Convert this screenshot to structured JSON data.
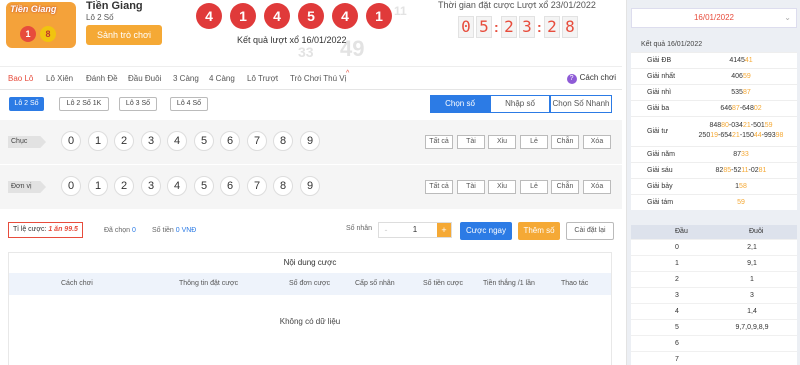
{
  "header": {
    "logo_text": "Tiền Giang",
    "logo_digits": [
      "1",
      "8"
    ],
    "game_title": "Tiền Giang",
    "game_sub": "Lô 2 Số",
    "switch_label": "Sảnh trò chơi",
    "balls": [
      "4",
      "1",
      "4",
      "5",
      "4",
      "1"
    ],
    "result_label": "Kết quả lượt xổ 16/01/2022",
    "watermark_numbers": [
      "49",
      "33",
      "11"
    ],
    "time_label": "Thời gian đặt cược Lượt xổ 23/01/2022",
    "timer": [
      "0",
      "5",
      "2",
      "3",
      "2",
      "8"
    ]
  },
  "tabs": {
    "items": [
      "Bao Lô",
      "Lô Xiên",
      "Đánh Đề",
      "Đầu Đuôi",
      "3 Càng",
      "4 Càng",
      "Lô Trượt",
      "Trò Chơi Thú Vị"
    ],
    "active": "Bao Lô",
    "hot_mark": "^",
    "help": "Cách chơi",
    "help_icon": "?"
  },
  "subtabs": [
    "Lô 2 Số",
    "Lô 2 Số 1K",
    "Lô 3 Số",
    "Lô 4 Số"
  ],
  "modes": [
    "Chọn số",
    "Nhập số",
    "Chọn Số Nhanh"
  ],
  "rows": [
    {
      "label": "Chục",
      "numbers": [
        "0",
        "1",
        "2",
        "3",
        "4",
        "5",
        "6",
        "7",
        "8",
        "9"
      ]
    },
    {
      "label": "Đơn vị",
      "numbers": [
        "0",
        "1",
        "2",
        "3",
        "4",
        "5",
        "6",
        "7",
        "8",
        "9"
      ]
    }
  ],
  "quick": [
    "Tất cả",
    "Tài",
    "Xỉu",
    "Lẻ",
    "Chẵn",
    "Xóa"
  ],
  "betbar": {
    "rate_label": "Tỉ lệ cược:",
    "rate_value": "1 ăn 99.5",
    "selected_label": "Đã chọn",
    "selected_value": "0",
    "amount_label": "Số tiền",
    "amount_value": "0 VNĐ",
    "multiplier_label": "Số nhân",
    "multiplier_value": "1",
    "bet_now": "Cược ngay",
    "add_number": "Thêm số",
    "reset": "Cài đặt lại"
  },
  "bet_table": {
    "title": "Nội dung cược",
    "columns": [
      "Cách chơi",
      "Thông tin đặt cược",
      "Số đơn cược",
      "Cấp số nhân",
      "Số tiền cược",
      "Tiền thắng /1 lần",
      "Thao tác"
    ],
    "empty": "Không có dữ liệu"
  },
  "right": {
    "date": "16/01/2022",
    "title": "Kết quả 16/01/2022",
    "prizes": [
      {
        "name": "Giải ĐB",
        "parts": [
          [
            "4145",
            ""
          ],
          [
            "41",
            "hl"
          ]
        ]
      },
      {
        "name": "Giải nhất",
        "parts": [
          [
            "406",
            ""
          ],
          [
            "59",
            "hl"
          ]
        ]
      },
      {
        "name": "Giải nhì",
        "parts": [
          [
            "535",
            ""
          ],
          [
            "87",
            "hl"
          ]
        ]
      },
      {
        "name": "Giải ba",
        "parts": [
          [
            "646",
            ""
          ],
          [
            "87",
            "hl"
          ],
          [
            "-648",
            ""
          ],
          [
            "02",
            "hl"
          ]
        ]
      },
      {
        "name": "Giải tư",
        "parts": [
          [
            "848",
            ""
          ],
          [
            "80",
            "hl"
          ],
          [
            "-034",
            ""
          ],
          [
            "21",
            "hl"
          ],
          [
            "-501",
            ""
          ],
          [
            "59",
            "hl"
          ],
          [
            "\n250",
            ""
          ],
          [
            "19",
            "hl"
          ],
          [
            "-654",
            ""
          ],
          [
            "21",
            "hl"
          ],
          [
            "-150",
            ""
          ],
          [
            "44",
            "hl"
          ],
          [
            "-993",
            ""
          ],
          [
            "98",
            "hl"
          ]
        ]
      },
      {
        "name": "Giải năm",
        "parts": [
          [
            "87",
            ""
          ],
          [
            "33",
            "hl"
          ]
        ]
      },
      {
        "name": "Giải sáu",
        "parts": [
          [
            "82",
            ""
          ],
          [
            "85",
            "hl"
          ],
          [
            "-52",
            ""
          ],
          [
            "11",
            "hl"
          ],
          [
            "-02",
            ""
          ],
          [
            "81",
            "hl"
          ]
        ]
      },
      {
        "name": "Giải bảy",
        "parts": [
          [
            "1",
            ""
          ],
          [
            "58",
            "hl"
          ]
        ]
      },
      {
        "name": "Giải tám",
        "parts": [
          [
            "59",
            "hl"
          ]
        ]
      }
    ],
    "dd_head": [
      "Đầu",
      "Đuôi"
    ],
    "dd_rows": [
      [
        "0",
        "2,1"
      ],
      [
        "1",
        "9,1"
      ],
      [
        "2",
        "1"
      ],
      [
        "3",
        "3"
      ],
      [
        "4",
        "1,4"
      ],
      [
        "5",
        "9,7,0,9,8,9"
      ],
      [
        "6",
        ""
      ],
      [
        "7",
        ""
      ]
    ],
    "colors": {
      "highlight": "#f5a935",
      "date": "#e74c3c"
    }
  }
}
